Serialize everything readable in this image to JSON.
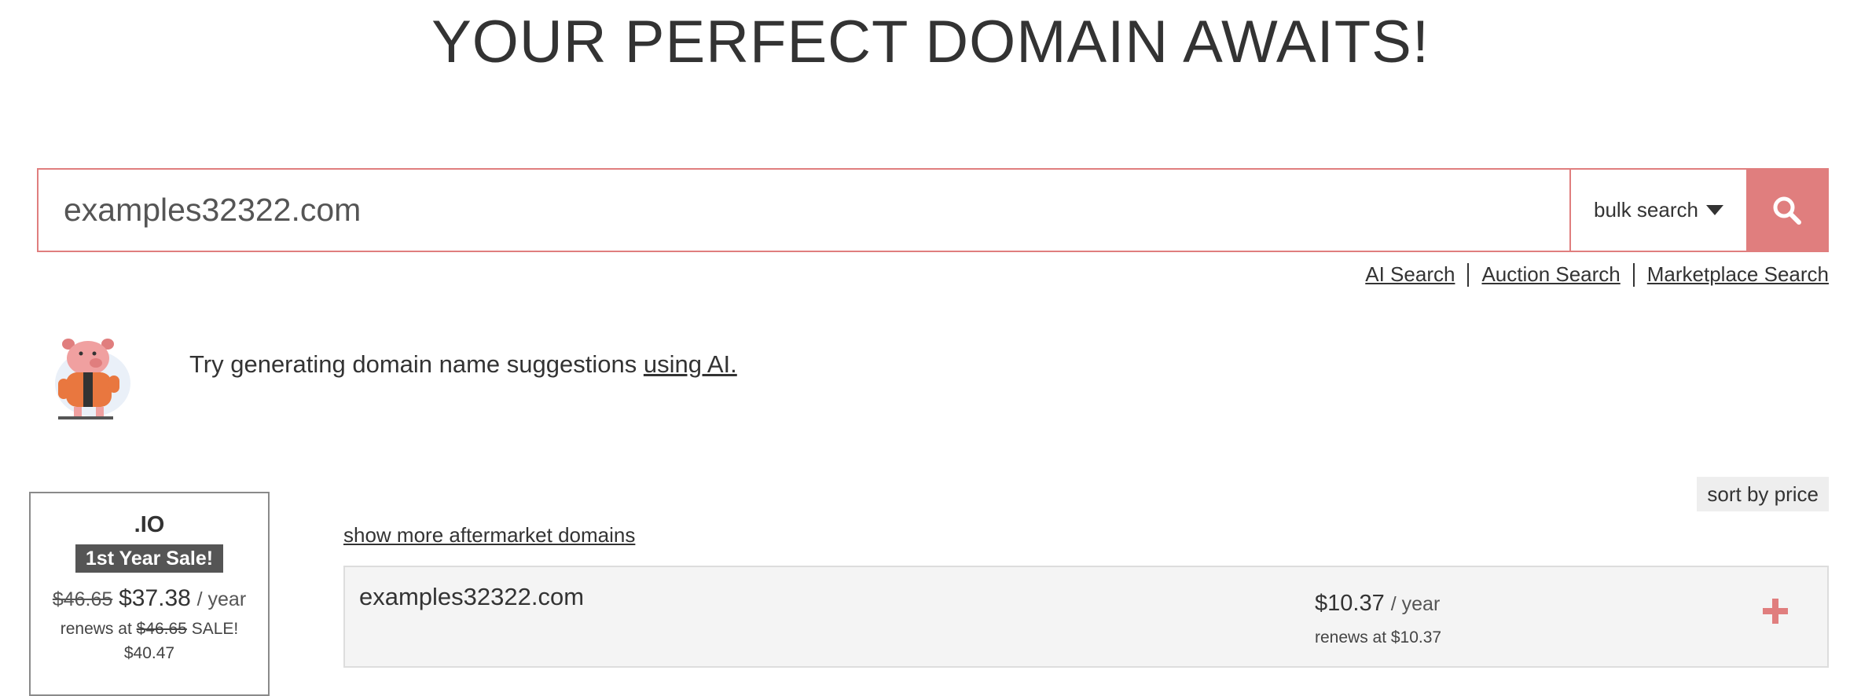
{
  "hero": {
    "title": "YOUR PERFECT DOMAIN AWAITS!"
  },
  "search": {
    "value": "examples32322.com",
    "bulk_label": "bulk search",
    "icon": "search-icon",
    "links": [
      "AI Search",
      "Auction Search",
      "Marketplace Search"
    ]
  },
  "ai_prompt": {
    "text": "Try generating domain name suggestions ",
    "link": "using AI."
  },
  "tld_card": {
    "tld": ".IO",
    "badge": "1st Year Sale!",
    "old_price": "$46.65",
    "price": "$37.38",
    "per": "/ year",
    "renew_prefix": "renews at",
    "renew_old": "$46.65",
    "renew_sale": "SALE!",
    "renew_price": "$40.47"
  },
  "results": {
    "sort_label": "sort by price",
    "more_link": "show more aftermarket domains",
    "rows": [
      {
        "domain": "examples32322.com",
        "price": "$10.37",
        "per": "/ year",
        "renew": "renews at $10.37"
      }
    ]
  },
  "colors": {
    "accent": "#e07e7e",
    "badge": "#555555",
    "row_bg": "#f4f4f4"
  }
}
